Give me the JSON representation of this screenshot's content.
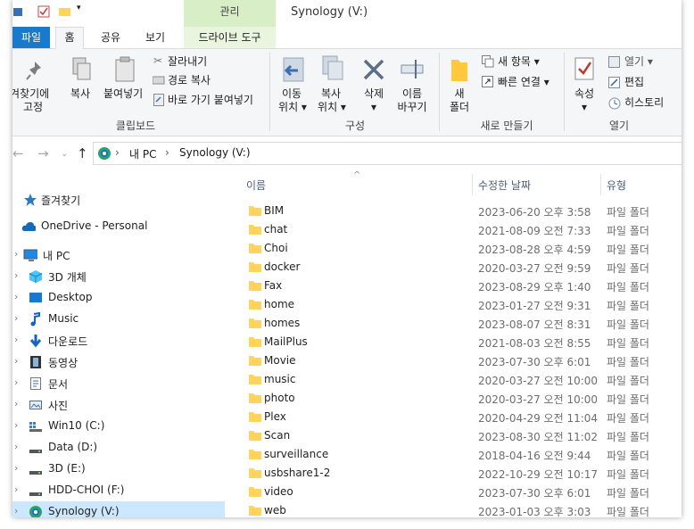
{
  "window": {
    "title": "Synology (V:)",
    "context_tab_header": "관리"
  },
  "tabs": {
    "file": "파일",
    "home": "홈",
    "share": "공유",
    "view": "보기",
    "drive_tools": "드라이브 도구"
  },
  "ribbon": {
    "clipboard": {
      "pin_line1": "즐겨찾기에",
      "pin_line2": "고정",
      "copy": "복사",
      "paste": "붙여넣기",
      "cut": "잘라내기",
      "copy_path": "경로 복사",
      "paste_shortcut": "바로 가기 붙여넣기",
      "group_label": "클립보드"
    },
    "organize": {
      "move_line1": "이동",
      "move_line2": "위치 ▾",
      "copyto_line1": "복사",
      "copyto_line2": "위치 ▾",
      "delete_line1": "삭제",
      "delete_line2": "▾",
      "rename_line1": "이름",
      "rename_line2": "바꾸기",
      "group_label": "구성"
    },
    "new": {
      "folder_line1": "새",
      "folder_line2": "폴더",
      "new_item": "새 항목 ▾",
      "easy_access": "빠른 연결 ▾",
      "group_label": "새로 만들기"
    },
    "open": {
      "properties_line1": "속성",
      "properties_line2": "▾",
      "open": "열기 ▾",
      "edit": "편집",
      "history": "히스토리",
      "group_label": "열기"
    }
  },
  "address": {
    "crumb_pc": "내 PC",
    "crumb_drive": "Synology (V:)",
    "sep": "›"
  },
  "nav": {
    "items": [
      {
        "label": "즐겨찾기",
        "icon": "star-icon"
      },
      {
        "label": "OneDrive - Personal",
        "icon": "cloud-icon"
      },
      {
        "label": "내 PC",
        "icon": "computer-icon"
      },
      {
        "label": "3D 개체",
        "icon": "cube-icon"
      },
      {
        "label": "Desktop",
        "icon": "desktop-icon"
      },
      {
        "label": "Music",
        "icon": "music-note-icon"
      },
      {
        "label": "다운로드",
        "icon": "download-arrow-icon"
      },
      {
        "label": "동영상",
        "icon": "film-icon"
      },
      {
        "label": "문서",
        "icon": "document-icon"
      },
      {
        "label": "사진",
        "icon": "picture-icon"
      },
      {
        "label": "Win10 (C:)",
        "icon": "windows-drive-icon"
      },
      {
        "label": "Data (D:)",
        "icon": "drive-icon"
      },
      {
        "label": "3D (E:)",
        "icon": "drive-icon"
      },
      {
        "label": "HDD-CHOI (F:)",
        "icon": "drive-icon"
      },
      {
        "label": "Synology (V:)",
        "icon": "network-drive-icon"
      }
    ]
  },
  "columns": {
    "name": "이름",
    "date": "수정한 날짜",
    "type": "유형"
  },
  "files": [
    {
      "name": "BIM",
      "date": "2023-06-20 오후 3:58",
      "type": "파일 폴더"
    },
    {
      "name": "chat",
      "date": "2021-08-09 오전 7:33",
      "type": "파일 폴더"
    },
    {
      "name": "Choi",
      "date": "2023-08-28 오후 4:59",
      "type": "파일 폴더"
    },
    {
      "name": "docker",
      "date": "2020-03-27 오전 9:59",
      "type": "파일 폴더"
    },
    {
      "name": "Fax",
      "date": "2023-08-29 오후 1:40",
      "type": "파일 폴더"
    },
    {
      "name": "home",
      "date": "2023-01-27 오전 9:31",
      "type": "파일 폴더"
    },
    {
      "name": "homes",
      "date": "2023-08-07 오전 8:31",
      "type": "파일 폴더"
    },
    {
      "name": "MailPlus",
      "date": "2021-08-03 오전 8:55",
      "type": "파일 폴더"
    },
    {
      "name": "Movie",
      "date": "2023-07-30 오후 6:01",
      "type": "파일 폴더"
    },
    {
      "name": "music",
      "date": "2020-03-27 오전 10:00",
      "type": "파일 폴더"
    },
    {
      "name": "photo",
      "date": "2020-03-27 오전 10:00",
      "type": "파일 폴더"
    },
    {
      "name": "Plex",
      "date": "2020-04-29 오전 11:04",
      "type": "파일 폴더"
    },
    {
      "name": "Scan",
      "date": "2023-08-30 오전 11:02",
      "type": "파일 폴더"
    },
    {
      "name": "surveillance",
      "date": "2018-04-16 오전 9:44",
      "type": "파일 폴더"
    },
    {
      "name": "usbshare1-2",
      "date": "2022-10-29 오전 10:17",
      "type": "파일 폴더"
    },
    {
      "name": "video",
      "date": "2023-07-30 오후 6:01",
      "type": "파일 폴더"
    },
    {
      "name": "web",
      "date": "2023-01-03 오후 3:03",
      "type": "파일 폴더"
    }
  ],
  "colors": {
    "accent": "#1979ca",
    "selection": "#cce8ff",
    "folder": "#ffd35c",
    "context_tab": "#d8eec7"
  }
}
